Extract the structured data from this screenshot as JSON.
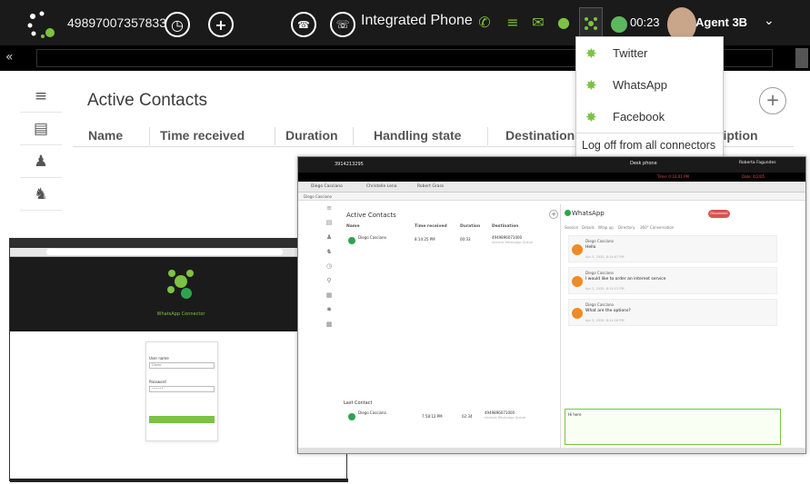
{
  "topbar": {
    "number": "49897007357833",
    "app_title": "Integrated Phone",
    "timer": "00:23",
    "agent": "Agent 3B"
  },
  "main": {
    "title": "Active Contacts",
    "columns": [
      "Name",
      "Time received",
      "Duration",
      "Handling state",
      "Destination",
      "ription"
    ]
  },
  "dropdown": {
    "items": [
      "Twitter",
      "WhatsApp",
      "Facebook"
    ],
    "logoff": "Log off from all connectors"
  },
  "login_inset": {
    "caption": "WhatsApp Connector",
    "user_label": "User name",
    "user_value": "Dieter",
    "pass_label": "Password",
    "pass_value": "••••••"
  },
  "wa_inset": {
    "top_number": "3914213295",
    "top_phone": "Desk phone",
    "top_agent": "Roberta Fagundes",
    "red_left": "Time: 0:16:01 PM",
    "red_right": "Date: 4/2/05",
    "tabs": [
      "Diego Casciano",
      "Christelle Lena",
      "Robert Grass"
    ],
    "crumb": "Diego Casciano",
    "active_title": "Active Contacts",
    "columns": [
      "Name",
      "Time received",
      "Duration",
      "Destination"
    ],
    "row1": {
      "name": "Diego Casciano",
      "time": "8:14:25 PM",
      "duration": "00:33",
      "dest": "4949896071000",
      "dest_sub": "Internal WhatsApp Queue"
    },
    "last_contact": "Last Contact",
    "row2": {
      "name": "Diego Casciano",
      "time": "7:58:12 PM",
      "duration": "02:34",
      "dest": "4949896071000",
      "dest_sub": "Internal WhatsApp Queue"
    },
    "rp_title": "WhatsApp",
    "disconnect": "Disconnect",
    "rp_tabs": [
      "Session",
      "Details",
      "Wrap up",
      "Directory",
      "360° Conversation"
    ],
    "messages": [
      {
        "name": "Diego Casciano",
        "text": "Hello",
        "date": "Apr 3, 2020, 8:14:07 PM"
      },
      {
        "name": "Diego Casciano",
        "text": "I would like to order an internet service",
        "date": "Apr 3, 2020, 8:14:13 PM"
      },
      {
        "name": "Diego Casciano",
        "text": "What are the options?",
        "date": "Apr 3, 2020, 8:14:16 PM"
      }
    ],
    "input_text": "Hi here"
  },
  "colors": {
    "accent_green": "#7dc242",
    "whatsapp_green": "#2ea44f",
    "topbar": "#1a1a1a"
  }
}
